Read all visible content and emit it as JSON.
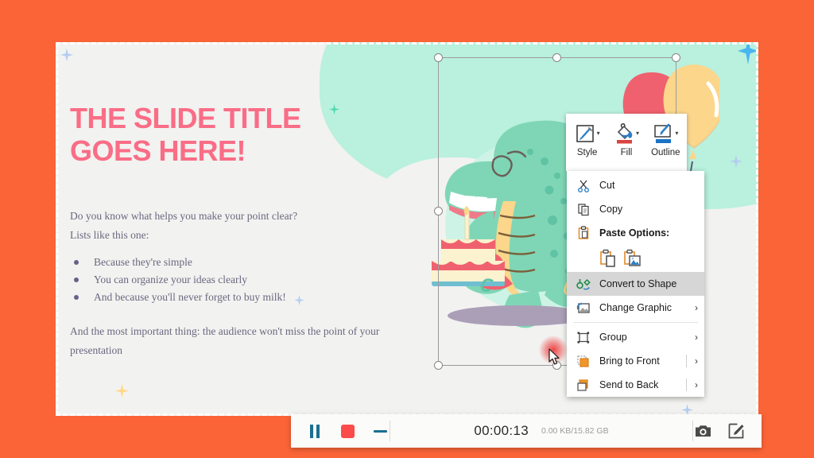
{
  "window": {
    "background_color": "#fa6437",
    "recording_border_color": "#ffffff"
  },
  "slide": {
    "title": "The Slide Title\nGoes Here!",
    "title_line1": "THE SLIDE TITLE",
    "title_line2": "GOES HERE!",
    "title_color": "#fa6d86",
    "intro_line1": "Do you know what helps you make your point clear?",
    "intro_line2": "Lists like this one:",
    "bullets": [
      "Because they're simple",
      "You can organize your ideas clearly",
      "And because you'll never forget to buy milk!"
    ],
    "outro": "And the most important thing: the audience won't miss the point of your presentation",
    "body_color": "#6a6880",
    "background_color": "#f2f2f0",
    "accent_mint": "#b9f0de",
    "illustration_name": "dinosaur-with-birthday-cake-and-balloons"
  },
  "mini_toolbar": {
    "items": [
      {
        "label": "Style",
        "icon": "style-brush-icon",
        "has_caret": true
      },
      {
        "label": "Fill",
        "icon": "fill-bucket-icon",
        "has_caret": true,
        "swatch": "#d9443f"
      },
      {
        "label": "Outline",
        "icon": "outline-pen-icon",
        "has_caret": true,
        "swatch": "#1a73c4"
      }
    ]
  },
  "context_menu": {
    "items": [
      {
        "label": "Cut",
        "accel": "t",
        "icon": "scissors-icon",
        "type": "item"
      },
      {
        "label": "Copy",
        "accel": "C",
        "icon": "copy-icon",
        "type": "item"
      },
      {
        "label": "Paste Options:",
        "icon": "clipboard-icon",
        "type": "header",
        "bold": true
      },
      {
        "type": "paste-options",
        "options": [
          {
            "label": "Keep Source Formatting",
            "icon": "paste-keep-formatting-icon"
          },
          {
            "label": "Picture",
            "icon": "paste-picture-icon"
          }
        ]
      },
      {
        "label": "Convert to Shape",
        "accel": "C",
        "icon": "convert-to-shape-icon",
        "type": "item",
        "highlighted": true
      },
      {
        "label": "Change Graphic",
        "accel": "C",
        "icon": "change-graphic-icon",
        "type": "item",
        "submenu": true
      },
      {
        "type": "separator"
      },
      {
        "label": "Group",
        "accel": "G",
        "icon": "group-icon",
        "type": "item",
        "submenu": true
      },
      {
        "label": "Bring to Front",
        "accel": "r",
        "icon": "bring-to-front-icon",
        "type": "item",
        "submenu": true,
        "divider_before_arrow": true
      },
      {
        "label": "Send to Back",
        "accel": "k",
        "icon": "send-to-back-icon",
        "type": "item",
        "submenu": true,
        "divider_before_arrow": true
      }
    ],
    "highlight_color": "#d6d6d6"
  },
  "recorder_bar": {
    "pause_label": "Pause",
    "stop_label": "Stop",
    "minimize_label": "Minimize",
    "timer": "00:00:13",
    "size": "0.00 KB/15.82 GB",
    "screenshot_label": "Screenshot",
    "annotate_label": "Annotate",
    "stop_color": "#fb4b4b",
    "control_color": "#1b6f91"
  },
  "selection": {
    "handle_count": 8,
    "frame_color": "#9b9b9b"
  },
  "cursor": {
    "click_highlight_color": "#eb2828"
  }
}
